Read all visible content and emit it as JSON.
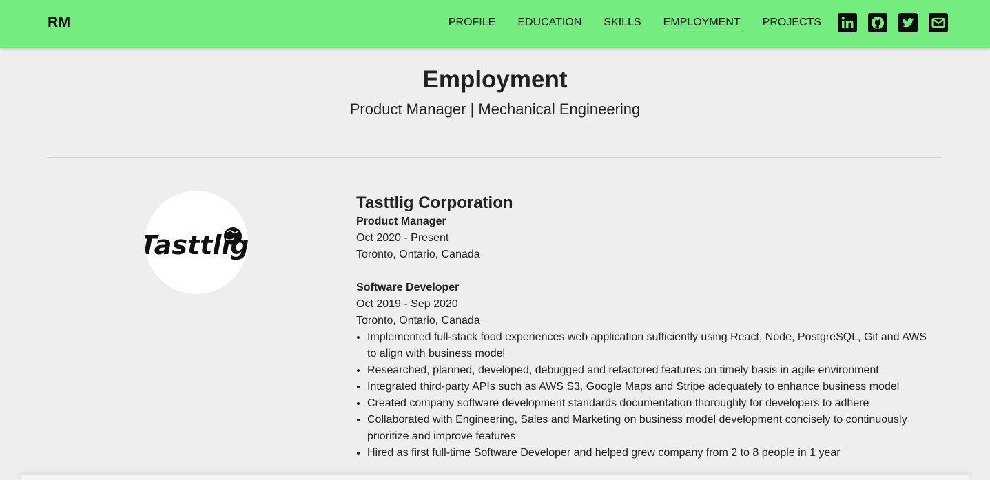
{
  "nav": {
    "brand": "RM",
    "links": [
      "PROFILE",
      "EDUCATION",
      "SKILLS",
      "EMPLOYMENT",
      "PROJECTS"
    ],
    "active_link": "EMPLOYMENT",
    "social_icons": [
      "linkedin-icon",
      "github-icon",
      "twitter-icon",
      "email-icon"
    ],
    "accent_color": "#74ec7f"
  },
  "header": {
    "title": "Employment",
    "subtitle": "Product Manager | Mechanical Engineering"
  },
  "employment": {
    "logo_text": "Tasttlig",
    "company": "Tasttlig Corporation",
    "roles": [
      {
        "title": "Product Manager",
        "dates": "Oct 2020 - Present",
        "location": "Toronto, Ontario, Canada"
      },
      {
        "title": "Software Developer",
        "dates": "Oct 2019 - Sep 2020",
        "location": "Toronto, Ontario, Canada",
        "bullets": [
          "Implemented full-stack food experiences web application sufficiently using React, Node, PostgreSQL, Git and AWS to align with business model",
          "Researched, planned, developed, debugged and refactored features on timely basis in agile environment",
          "Integrated third-party APIs such as AWS S3, Google Maps and Stripe adequately to enhance business model",
          "Created company software development standards documentation thoroughly for developers to adhere",
          "Collaborated with Engineering, Sales and Marketing on business model development concisely to continuously prioritize and improve features",
          "Hired as first full-time Software Developer and helped grew company from 2 to 8 people in 1 year"
        ]
      }
    ]
  }
}
